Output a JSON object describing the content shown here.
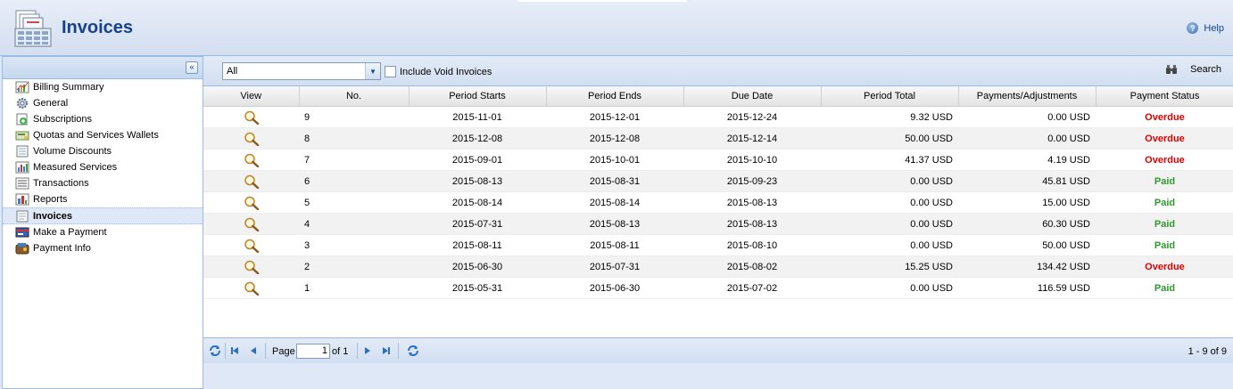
{
  "header": {
    "title": "Invoices",
    "help_label": "Help"
  },
  "sidebar": {
    "collapse_glyph": "«",
    "items": [
      {
        "label": "Billing Summary",
        "icon": "billing-summary-icon"
      },
      {
        "label": "General",
        "icon": "gear-icon"
      },
      {
        "label": "Subscriptions",
        "icon": "subscriptions-icon"
      },
      {
        "label": "Quotas and Services Wallets",
        "icon": "wallet-icon"
      },
      {
        "label": "Volume Discounts",
        "icon": "discount-icon"
      },
      {
        "label": "Measured Services",
        "icon": "measured-services-icon"
      },
      {
        "label": "Transactions",
        "icon": "transactions-icon"
      },
      {
        "label": "Reports",
        "icon": "reports-icon"
      },
      {
        "label": "Invoices",
        "icon": "invoice-icon",
        "active": true
      },
      {
        "label": "Make a Payment",
        "icon": "payment-card-icon"
      },
      {
        "label": "Payment Info",
        "icon": "payment-info-icon"
      }
    ]
  },
  "toolbar": {
    "filter_value": "All",
    "void_label": "Include Void Invoices",
    "search_label": "Search"
  },
  "grid": {
    "columns": [
      "View",
      "No.",
      "Period Starts",
      "Period Ends",
      "Due Date",
      "Period Total",
      "Payments/Adjustments",
      "Payment Status"
    ],
    "rows": [
      {
        "no": "9",
        "start": "2015-11-01",
        "end": "2015-12-01",
        "due": "2015-12-24",
        "total": "9.32 USD",
        "payments": "0.00 USD",
        "status": "Overdue"
      },
      {
        "no": "8",
        "start": "2015-12-08",
        "end": "2015-12-08",
        "due": "2015-12-14",
        "total": "50.00 USD",
        "payments": "0.00 USD",
        "status": "Overdue"
      },
      {
        "no": "7",
        "start": "2015-09-01",
        "end": "2015-10-01",
        "due": "2015-10-10",
        "total": "41.37 USD",
        "payments": "4.19 USD",
        "status": "Overdue"
      },
      {
        "no": "6",
        "start": "2015-08-13",
        "end": "2015-08-31",
        "due": "2015-09-23",
        "total": "0.00 USD",
        "payments": "45.81 USD",
        "status": "Paid"
      },
      {
        "no": "5",
        "start": "2015-08-14",
        "end": "2015-08-14",
        "due": "2015-08-13",
        "total": "0.00 USD",
        "payments": "15.00 USD",
        "status": "Paid"
      },
      {
        "no": "4",
        "start": "2015-07-31",
        "end": "2015-08-13",
        "due": "2015-08-13",
        "total": "0.00 USD",
        "payments": "60.30 USD",
        "status": "Paid"
      },
      {
        "no": "3",
        "start": "2015-08-11",
        "end": "2015-08-11",
        "due": "2015-08-10",
        "total": "0.00 USD",
        "payments": "50.00 USD",
        "status": "Paid"
      },
      {
        "no": "2",
        "start": "2015-06-30",
        "end": "2015-07-31",
        "due": "2015-08-02",
        "total": "15.25 USD",
        "payments": "134.42 USD",
        "status": "Overdue"
      },
      {
        "no": "1",
        "start": "2015-05-31",
        "end": "2015-06-30",
        "due": "2015-07-02",
        "total": "0.00 USD",
        "payments": "116.59 USD",
        "status": "Paid"
      }
    ]
  },
  "paging": {
    "page_label": "Page",
    "page_value": "1",
    "of_label": "of 1",
    "count_label": "1 - 9 of 9"
  },
  "colors": {
    "title": "#15428b",
    "overdue": "#dd0000",
    "paid": "#2e9a2e",
    "border": "#99bbe8"
  }
}
